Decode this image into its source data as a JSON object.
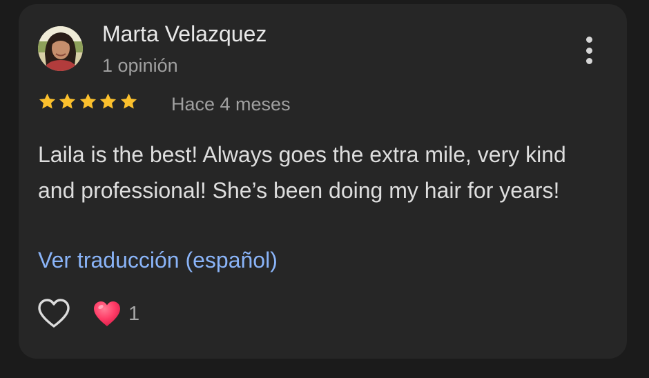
{
  "review": {
    "reviewer_name": "Marta Velazquez",
    "review_count": "1 opinión",
    "rating": 5,
    "rating_max": 5,
    "age": "Hace 4 meses",
    "text": "Laila is the best! Always goes the extra mile, very kind and professional! She’s been doing my hair for years!",
    "translate_label": "Ver traducción (español)",
    "reactions": {
      "heart_count": "1"
    }
  },
  "icons": {
    "avatar": "avatar",
    "more": "more-vert-icon",
    "star": "star-icon",
    "like": "heart-outline-icon",
    "reaction": "heart-emoji-icon"
  },
  "colors": {
    "background": "#1b1b1b",
    "card": "#262626",
    "star": "#fbc02d",
    "link": "#8ab4f8",
    "reaction_heart": "#ff3b66"
  }
}
